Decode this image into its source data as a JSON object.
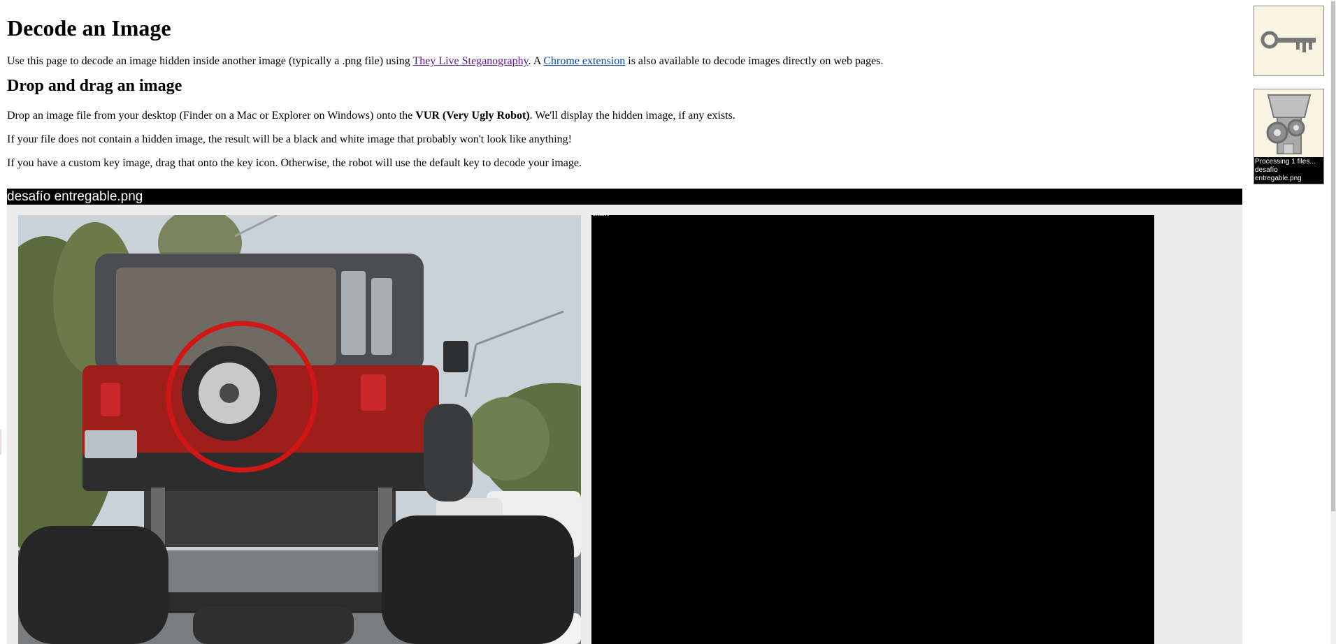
{
  "page": {
    "title": "Decode an Image",
    "intro": {
      "before": "Use this page to decode an image hidden inside another image (typically a .png file) using ",
      "link1": "They Live Steganography",
      "middle": ". A ",
      "link2": "Chrome extension",
      "after": " is also available to decode images directly on web pages."
    },
    "section_heading": "Drop and drag an image",
    "para1": {
      "before": "Drop an image file from your desktop (Finder on a Mac or Explorer on Windows) onto the ",
      "bold": "VUR (Very Ugly Robot)",
      "after": ". We'll display the hidden image, if any exists."
    },
    "para2": "If your file does not contain a hidden image, the result will be a black and white image that probably won't look like anything!",
    "para3": "If you have a custom key image, drag that onto the key icon. Otherwise, the robot will use the default key to decode your image."
  },
  "file": {
    "name": "desafío entregable.png",
    "decoded_caption": "decoded"
  },
  "sidebar": {
    "key_icon": "key-icon",
    "robot_icon": "robot-grinder-icon",
    "status_line1": "Processing 1 files...",
    "status_line2": "desafío entregable.png"
  },
  "colors": {
    "panel_bg": "#ececec",
    "sidebar_bg": "#f7f4e2",
    "visited_link": "#551a8b",
    "link": "#0645ad"
  }
}
